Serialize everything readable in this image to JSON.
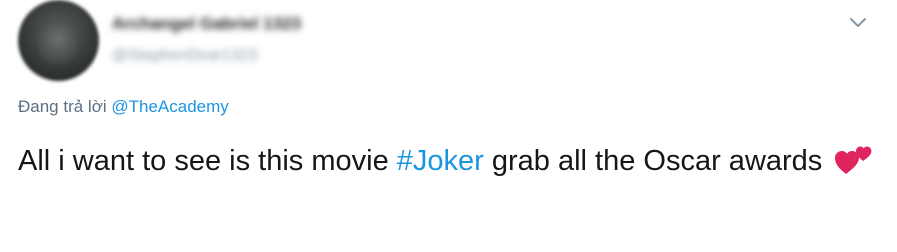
{
  "author": {
    "display_name": "Archangel Gabriel 1323",
    "handle": "@StephenDvar1323"
  },
  "reply": {
    "prefix": "Đang trả lời",
    "mention": "@TheAcademy"
  },
  "tweet": {
    "text_before": "All i want to see is this movie ",
    "hashtag": "#Joker",
    "text_after": " grab all the Oscar awards ",
    "emoji": "two-hearts-icon"
  },
  "colors": {
    "link": "#1b95e0",
    "text": "#14171a",
    "secondary": "#5b7083",
    "heart": "#e0245e"
  },
  "icons": {
    "menu": "chevron-down-icon"
  }
}
